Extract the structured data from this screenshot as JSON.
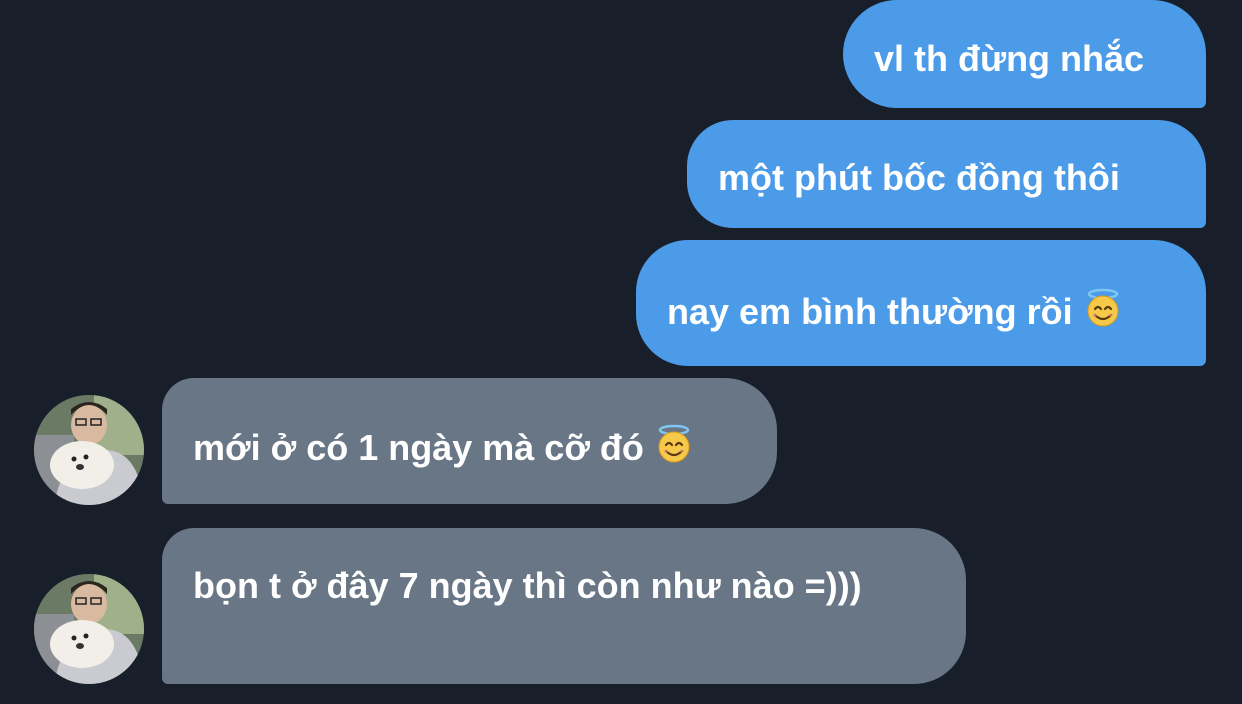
{
  "conversation": {
    "messages": [
      {
        "direction": "sent",
        "text": "vl th đừng nhắc",
        "emoji": null
      },
      {
        "direction": "sent",
        "text": "một phút bốc đồng thôi",
        "emoji": null
      },
      {
        "direction": "sent",
        "text": "nay em bình thường rồi",
        "emoji": "smiling-face-with-halo"
      },
      {
        "direction": "received",
        "text": "mới ở có 1 ngày mà cỡ đó",
        "emoji": "smiling-face-with-halo"
      },
      {
        "direction": "received",
        "text": "bọn t ở đây 7 ngày thì còn như nào =)))",
        "emoji": null
      }
    ]
  },
  "colors": {
    "background": "#181f2a",
    "sent_bubble": "#4b9be8",
    "received_bubble": "#687685",
    "text": "#ffffff"
  }
}
